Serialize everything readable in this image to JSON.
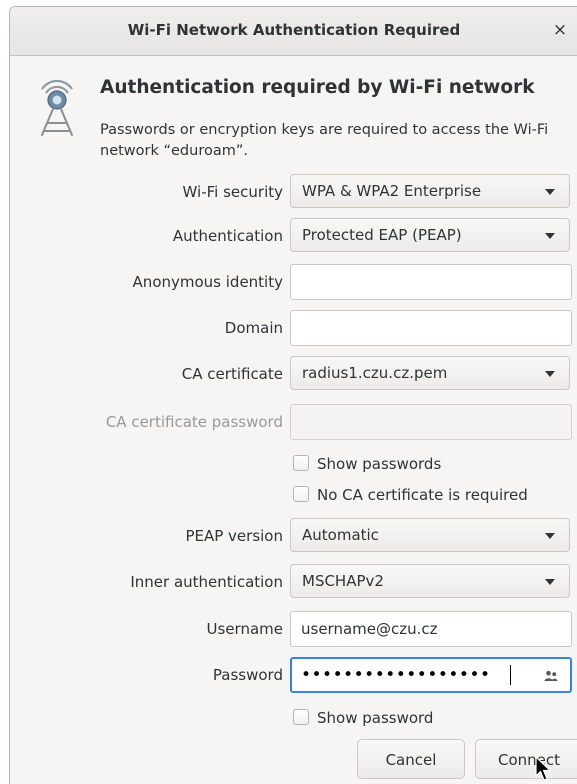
{
  "dialog": {
    "title": "Wi-Fi Network Authentication Required",
    "close_glyph": "×",
    "icon": "wireless-network-icon",
    "heading": "Authentication required by Wi-Fi network",
    "description": "Passwords or encryption keys are required to access the Wi-Fi network “eduroam”."
  },
  "form": {
    "wifi_security": {
      "label": "Wi-Fi security",
      "value": "WPA & WPA2 Enterprise"
    },
    "authentication": {
      "label": "Authentication",
      "value": "Protected EAP (PEAP)"
    },
    "anonymous_identity": {
      "label": "Anonymous identity",
      "value": ""
    },
    "domain": {
      "label": "Domain",
      "value": ""
    },
    "ca_certificate": {
      "label": "CA certificate",
      "value": "radius1.czu.cz.pem"
    },
    "ca_certificate_password": {
      "label": "CA certificate password",
      "value": "",
      "disabled": true
    },
    "show_passwords": {
      "label": "Show passwords",
      "checked": false
    },
    "no_ca_required": {
      "label": "No CA certificate is required",
      "checked": false
    },
    "peap_version": {
      "label": "PEAP version",
      "value": "Automatic"
    },
    "inner_authentication": {
      "label": "Inner authentication",
      "value": "MSCHAPv2"
    },
    "username": {
      "label": "Username",
      "value": "username@czu.cz"
    },
    "password": {
      "label": "Password",
      "masked_value": "••••••••••••••••••"
    },
    "show_password": {
      "label": "Show password",
      "checked": false
    }
  },
  "buttons": {
    "cancel": "Cancel",
    "connect": "Connect"
  },
  "colors": {
    "dialog_bg": "#f6f5f4",
    "focus_accent": "#3584e4",
    "text": "#2e3436",
    "disabled_text": "#979a9b"
  }
}
